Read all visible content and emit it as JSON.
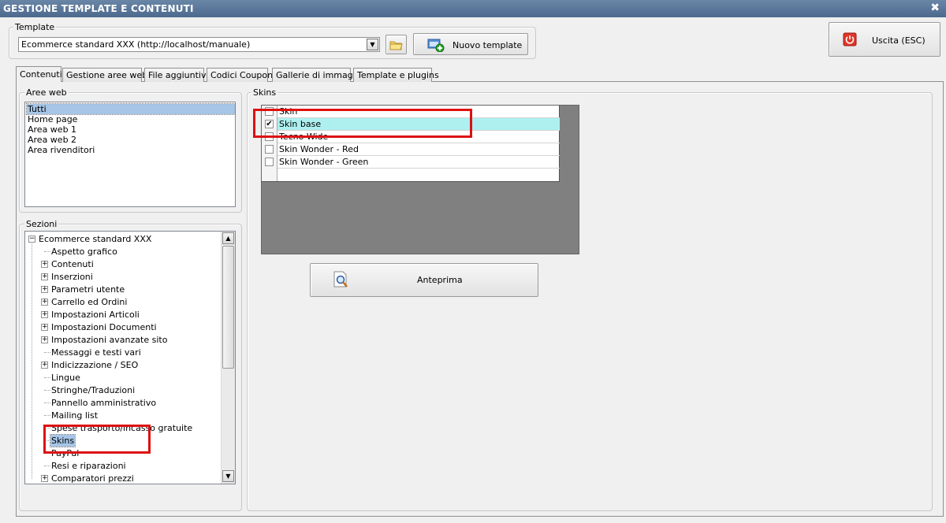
{
  "window": {
    "title": "GESTIONE TEMPLATE E CONTENUTI",
    "close_glyph": "✖"
  },
  "template_group": {
    "label": "Template",
    "selected": "Ecommerce standard XXX (http://localhost/manuale)",
    "new_template_label": "Nuovo template"
  },
  "exit_button": {
    "label": "Uscita (ESC)"
  },
  "tabs": [
    {
      "label": "Contenuti",
      "active": true
    },
    {
      "label": "Gestione aree web"
    },
    {
      "label": "File aggiuntivi"
    },
    {
      "label": "Codici Coupon"
    },
    {
      "label": "Gallerie di immagini"
    },
    {
      "label": "Template e plugins"
    }
  ],
  "aree_web": {
    "label": "Aree web",
    "items": [
      "Tutti",
      "Home page",
      "Area web 1",
      "Area web 2",
      "Area rivenditori"
    ],
    "selected_index": 0
  },
  "sezioni": {
    "label": "Sezioni",
    "root": "Ecommerce standard XXX",
    "items": [
      {
        "label": "Aspetto grafico",
        "expandable": false
      },
      {
        "label": "Contenuti",
        "expandable": true
      },
      {
        "label": "Inserzioni",
        "expandable": true
      },
      {
        "label": "Parametri utente",
        "expandable": true
      },
      {
        "label": "Carrello ed Ordini",
        "expandable": true
      },
      {
        "label": "Impostazioni Articoli",
        "expandable": true
      },
      {
        "label": "Impostazioni Documenti",
        "expandable": true
      },
      {
        "label": "Impostazioni avanzate sito",
        "expandable": true
      },
      {
        "label": "Messaggi e testi vari",
        "expandable": false
      },
      {
        "label": "Indicizzazione / SEO",
        "expandable": true
      },
      {
        "label": "Lingue",
        "expandable": false
      },
      {
        "label": "Stringhe/Traduzioni",
        "expandable": false
      },
      {
        "label": "Pannello amministrativo",
        "expandable": false
      },
      {
        "label": "Mailing list",
        "expandable": false
      },
      {
        "label": "Spese trasporto/incasso gratuite",
        "expandable": false
      },
      {
        "label": "Skins",
        "expandable": false,
        "selected": true
      },
      {
        "label": "PayPal",
        "expandable": false
      },
      {
        "label": "Resi e riparazioni",
        "expandable": false
      },
      {
        "label": "Comparatori prezzi",
        "expandable": true
      }
    ]
  },
  "skins": {
    "label": "Skins",
    "rows": [
      {
        "name": "Skin",
        "checked": false,
        "selected": false
      },
      {
        "name": "Skin base",
        "checked": true,
        "selected": true
      },
      {
        "name": "Tecno Wide",
        "checked": false,
        "selected": false
      },
      {
        "name": "Skin Wonder - Red",
        "checked": false,
        "selected": false
      },
      {
        "name": "Skin Wonder - Green",
        "checked": false,
        "selected": false
      }
    ],
    "preview_label": "Anteprima"
  },
  "colors": {
    "title_bar": "#4c6a8e",
    "highlight_box": "#dd1111",
    "selected_row": "#aef0f0",
    "selected_list": "#a6c5e7"
  },
  "icons": {
    "folder": "folder-icon",
    "new_template": "add-window-icon",
    "exit": "power-icon",
    "preview": "magnifier-document-icon"
  }
}
